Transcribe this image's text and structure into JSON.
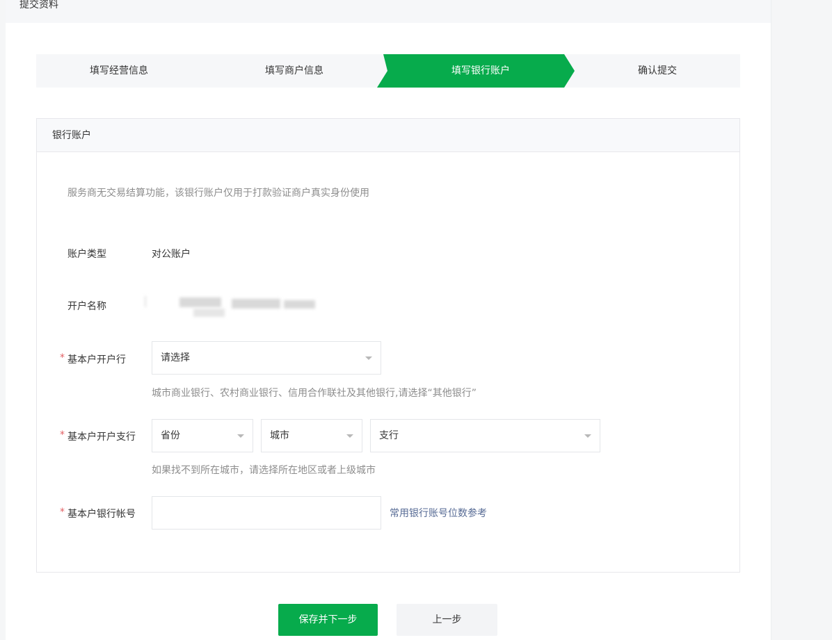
{
  "page": {
    "title": "提交资料"
  },
  "steps": [
    {
      "label": "填写经营信息",
      "active": false
    },
    {
      "label": "填写商户信息",
      "active": false
    },
    {
      "label": "填写银行账户",
      "active": true
    },
    {
      "label": "确认提交",
      "active": false
    }
  ],
  "panel": {
    "title": "银行账户",
    "notice": "服务商无交易结算功能，该银行账户仅用于打款验证商户真实身份使用",
    "account_type": {
      "label": "账户类型",
      "value": "对公账户"
    },
    "account_name": {
      "label": "开户名称"
    },
    "bank": {
      "required_mark": "*",
      "label": "基本户开户行",
      "selected": "请选择",
      "hint": "城市商业银行、农村商业银行、信用合作联社及其他银行,请选择“其他银行”"
    },
    "branch": {
      "required_mark": "*",
      "label": "基本户开户支行",
      "province": "省份",
      "city": "城市",
      "branch": "支行",
      "hint": "如果找不到所在城市，请选择所在地区或者上级城市"
    },
    "account_number": {
      "required_mark": "*",
      "label": "基本户银行帐号",
      "value": "",
      "link": "常用银行账号位数参考"
    }
  },
  "buttons": {
    "save_next": "保存并下一步",
    "prev": "上一步"
  },
  "colors": {
    "accent": "#07ab4c",
    "step_bg": "#f6f7f9",
    "link": "#576b95",
    "required": "#e15f63"
  }
}
